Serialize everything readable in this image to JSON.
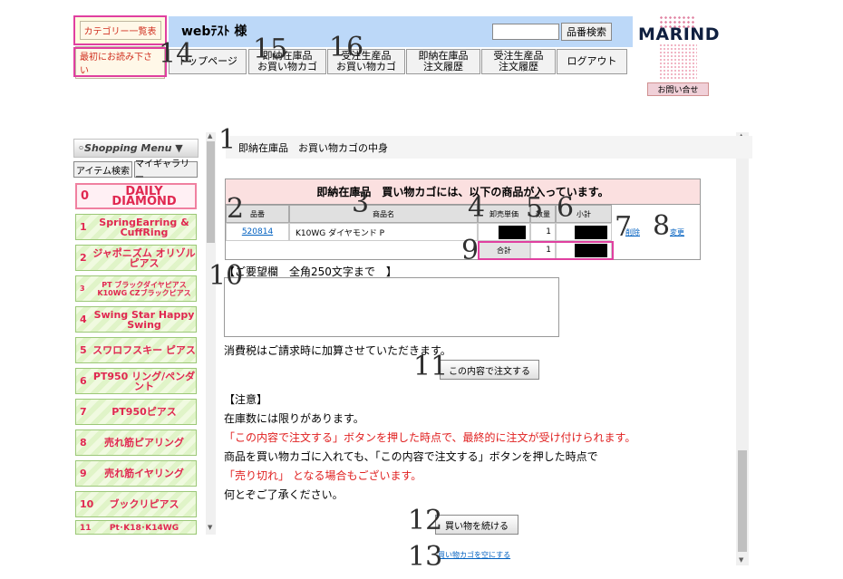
{
  "header": {
    "category_button": "カテゴリー一覧表",
    "first_read_button": "最初にお読み下さい",
    "user_name": "webﾃｽﾄ 様",
    "search_button": "品番検索",
    "nav": [
      {
        "line1": "トップページ",
        "line2": ""
      },
      {
        "line1": "即納在庫品",
        "line2": "お買い物カゴ"
      },
      {
        "line1": "受注生産品",
        "line2": "お買い物カゴ"
      },
      {
        "line1": "即納在庫品",
        "line2": "注文履歴"
      },
      {
        "line1": "受注生産品",
        "line2": "注文履歴"
      },
      {
        "line1": "ログアウト",
        "line2": ""
      }
    ],
    "logo": "MARIND",
    "contact_button": "お問い合せ"
  },
  "sidebar": {
    "title": "◦Shopping Menu ▼",
    "tabs": [
      "アイテム検索",
      "マイギャラリー"
    ],
    "categories": [
      {
        "num": "0",
        "label": "DAILY DIAMOND"
      },
      {
        "num": "1",
        "label": "SpringEarring & CuffRing"
      },
      {
        "num": "2",
        "label": "ジャポニズム オリゾルピアス"
      },
      {
        "num": "3",
        "label": "PT ブラックダイヤピアス K10WG CZブラックピアス"
      },
      {
        "num": "4",
        "label": "Swing Star Happy Swing"
      },
      {
        "num": "5",
        "label": "スワロフスキー ピアス"
      },
      {
        "num": "6",
        "label": "PT950 リング/ペンダント"
      },
      {
        "num": "7",
        "label": "PT950ピアス"
      },
      {
        "num": "8",
        "label": "売れ筋ピアリング"
      },
      {
        "num": "9",
        "label": "売れ筋イヤリング"
      },
      {
        "num": "10",
        "label": "ブックリピアス"
      },
      {
        "num": "11",
        "label": "Pt･K18･K14WG"
      }
    ]
  },
  "main": {
    "breadcrumb": "即納在庫品　お買い物カゴの中身",
    "cart_title": "即納在庫品　買い物カゴには、以下の商品が入っています。",
    "columns": [
      "品番",
      "商品名",
      "卸売単価",
      "数量",
      "小計"
    ],
    "row": {
      "code": "520814",
      "name": "K10WG ダイヤモンド P",
      "qty": "1",
      "delete": "削除",
      "change": "変更"
    },
    "total_label": "合計",
    "total_qty": "1",
    "remarks_label": "【ご要望欄　全角250文字まで　】",
    "tax_note": "消費税はご請求時に加算させていただきます。",
    "order_button": "この内容で注文する",
    "notice_title": "【注意】",
    "notice_lines": [
      "在庫数には限りがあります。",
      "「この内容で注文する」ボタンを押した時点で、最終的に注文が受け付けられます。",
      "商品を買い物カゴに入れても、「この内容で注文する」ボタンを押した時点で",
      "「売り切れ」 となる場合もございます。",
      "何とぞご了承ください。"
    ],
    "continue_button": "買い物を続ける",
    "empty_cart_link": "買い物カゴを空にする"
  },
  "annotations": [
    "1",
    "2",
    "3",
    "4",
    "5",
    "6",
    "7",
    "8",
    "9",
    "10",
    "11",
    "12",
    "13",
    "14",
    "15",
    "16"
  ],
  "colors": {
    "annotation_box": "#e040a0",
    "header_bar": "#bcd8f8",
    "cart_header": "#fbe0e0",
    "category_text": "#e02850"
  }
}
